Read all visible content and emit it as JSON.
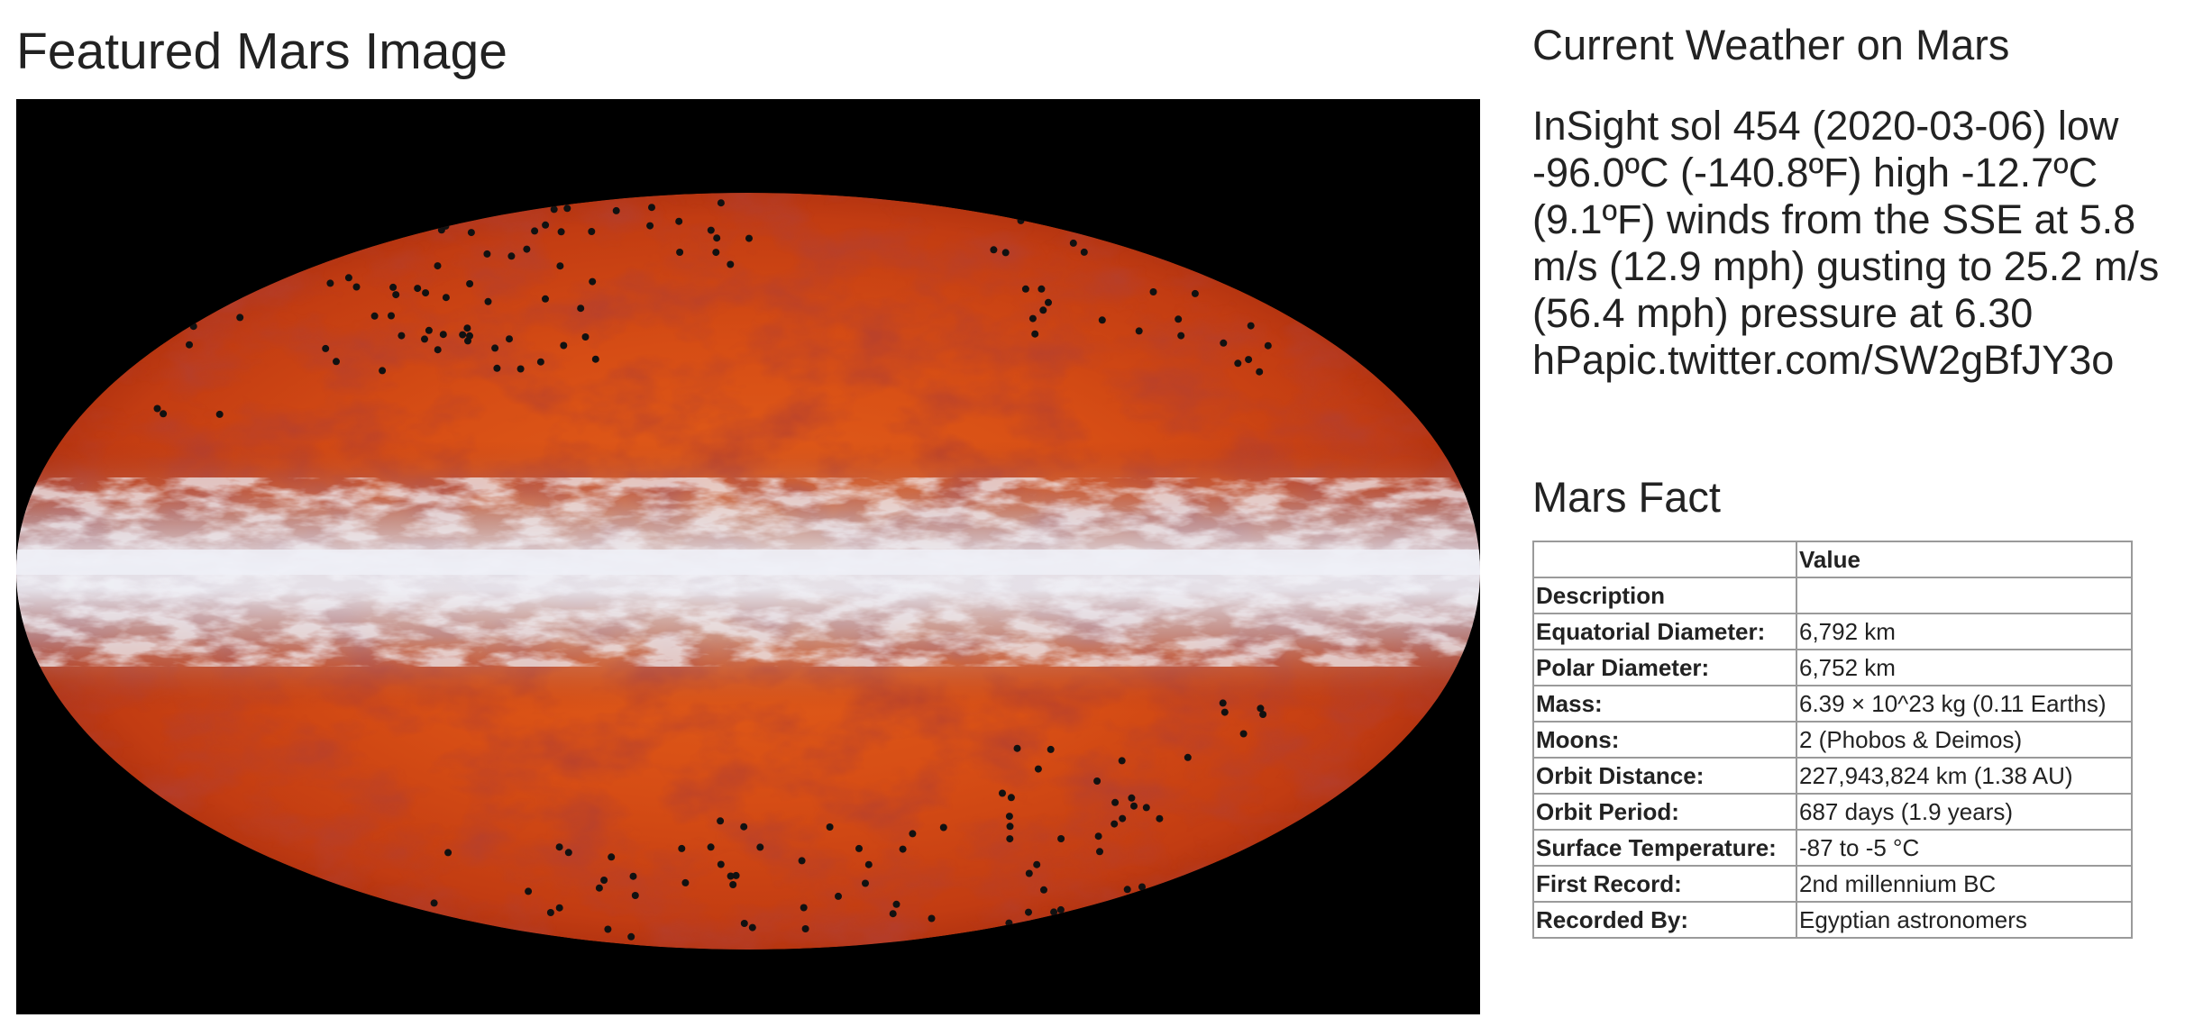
{
  "featured": {
    "title": "Featured Mars Image",
    "image_icon": "mollweide-all-sky-map-image",
    "colors": {
      "background": "#000000",
      "map_base": "#d94e14",
      "map_dark": "#8e1a0c",
      "map_light": "#f07a26",
      "band": "#dfe2ef",
      "dots": "#111111"
    }
  },
  "weather": {
    "heading": "Current Weather on Mars",
    "text": "InSight sol 454 (2020-03-06) low -96.0ºC (-140.8ºF) high -12.7ºC (9.1ºF) winds from the SSE at 5.8 m/s (12.9 mph) gusting to 25.2 m/s (56.4 mph) pressure at 6.30 hPapic.twitter.com/SW2gBfJY3o"
  },
  "facts": {
    "heading": "Mars Fact",
    "header": {
      "label": "",
      "value": "Value"
    },
    "description_label": "Description",
    "rows": [
      {
        "label": "Equatorial Diameter:",
        "value": "6,792 km"
      },
      {
        "label": "Polar Diameter:",
        "value": "6,752 km"
      },
      {
        "label": "Mass:",
        "value": "6.39 × 10^23 kg (0.11 Earths)"
      },
      {
        "label": "Moons:",
        "value": "2 (Phobos & Deimos)"
      },
      {
        "label": "Orbit Distance:",
        "value": "227,943,824 km (1.38 AU)"
      },
      {
        "label": "Orbit Period:",
        "value": "687 days (1.9 years)"
      },
      {
        "label": "Surface Temperature:",
        "value": "-87 to -5 °C"
      },
      {
        "label": "First Record:",
        "value": "2nd millennium BC"
      },
      {
        "label": "Recorded By:",
        "value": "Egyptian astronomers"
      }
    ]
  }
}
